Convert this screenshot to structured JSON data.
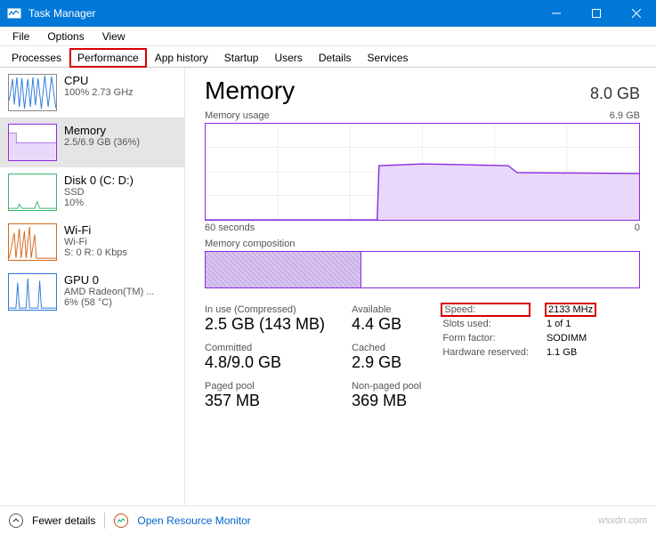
{
  "window": {
    "title": "Task Manager"
  },
  "menu": {
    "file": "File",
    "options": "Options",
    "view": "View"
  },
  "tabs": {
    "processes": "Processes",
    "performance": "Performance",
    "app_history": "App history",
    "startup": "Startup",
    "users": "Users",
    "details": "Details",
    "services": "Services"
  },
  "sidebar": [
    {
      "title": "CPU",
      "sub": "100% 2.73 GHz",
      "color": "#2a7ada"
    },
    {
      "title": "Memory",
      "sub": "2.5/6.9 GB (36%)",
      "color": "#8a2be2"
    },
    {
      "title": "Disk 0 (C: D:)",
      "sub1": "SSD",
      "sub2": "10%",
      "color": "#3cb371"
    },
    {
      "title": "Wi-Fi",
      "sub1": "Wi-Fi",
      "sub2": "S: 0 R: 0 Kbps",
      "color": "#d2691e"
    },
    {
      "title": "GPU 0",
      "sub1": "AMD Radeon(TM) ...",
      "sub2": "6% (58 °C)",
      "color": "#2a7ada"
    }
  ],
  "main": {
    "title": "Memory",
    "capacity": "8.0 GB",
    "usage_label": "Memory usage",
    "usage_max": "6.9 GB",
    "axis_left": "60 seconds",
    "axis_right": "0",
    "comp_label": "Memory composition"
  },
  "stats_left": [
    {
      "label": "In use (Compressed)",
      "value": "2.5 GB (143 MB)"
    },
    {
      "label": "Available",
      "value": "4.4 GB"
    },
    {
      "label": "Committed",
      "value": "4.8/9.0 GB"
    },
    {
      "label": "Cached",
      "value": "2.9 GB"
    },
    {
      "label": "Paged pool",
      "value": "357 MB"
    },
    {
      "label": "Non-paged pool",
      "value": "369 MB"
    }
  ],
  "stats_right": [
    {
      "label": "Speed:",
      "value": "2133 MHz",
      "highlight": true
    },
    {
      "label": "Slots used:",
      "value": "1 of 1"
    },
    {
      "label": "Form factor:",
      "value": "SODIMM"
    },
    {
      "label": "Hardware reserved:",
      "value": "1.1 GB"
    }
  ],
  "footer": {
    "fewer": "Fewer details",
    "monitor": "Open Resource Monitor"
  },
  "watermark": "wsxdn.com",
  "chart_data": {
    "type": "area",
    "title": "Memory usage",
    "ylabel": "GB",
    "ylim": [
      0,
      6.9
    ],
    "xlabel": "seconds ago",
    "xlim": [
      60,
      0
    ],
    "x": [
      60,
      45,
      36,
      35,
      30,
      18,
      17,
      0
    ],
    "values": [
      0,
      0,
      0,
      3.8,
      3.9,
      3.7,
      3.3,
      3.3
    ],
    "composition": {
      "in_use_gb": 2.5,
      "total_gb": 6.9
    }
  }
}
